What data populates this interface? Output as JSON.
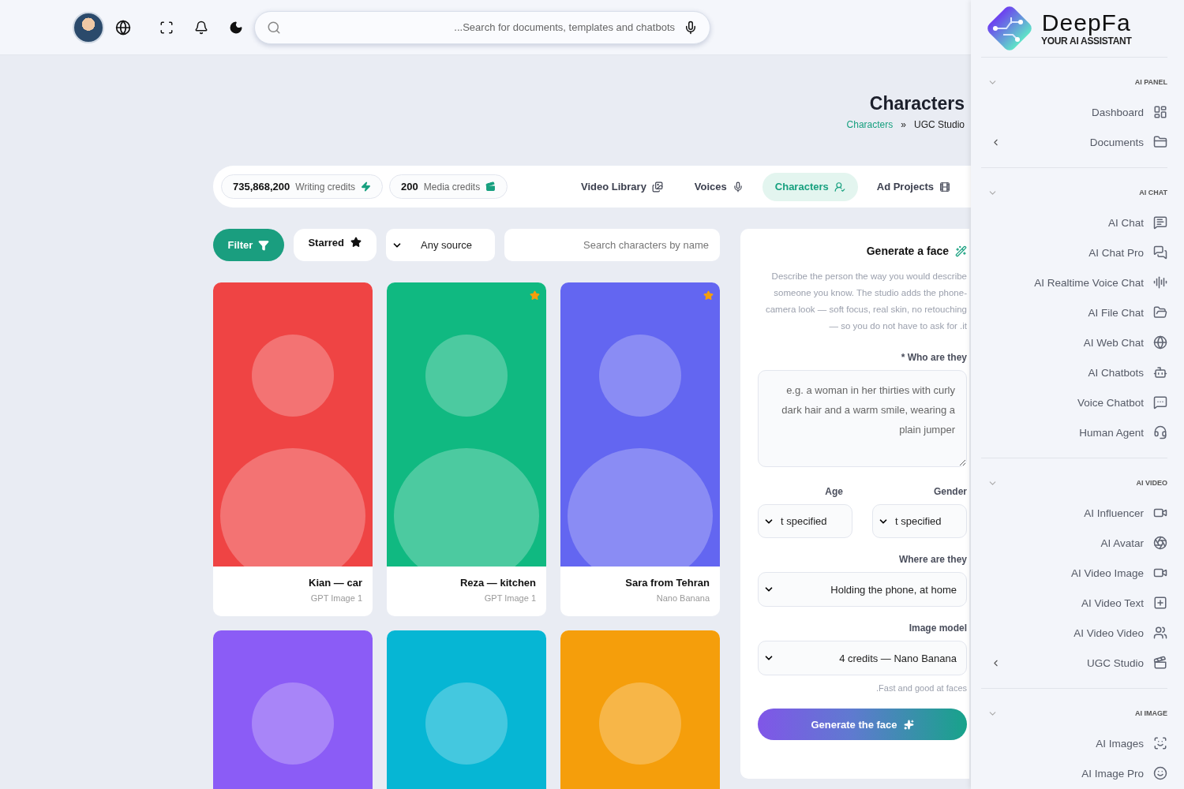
{
  "topbar": {
    "search": {
      "placeholder": "...Search for documents, templates and chatbots"
    }
  },
  "header": {
    "title": "Characters",
    "breadcrumbs": [
      {
        "label": "Characters",
        "link": true
      },
      {
        "label": "»",
        "link": false
      },
      {
        "label": "UGC Studio",
        "link": false
      }
    ]
  },
  "credits": [
    {
      "amount": "735,868,200",
      "label": "Writing credits",
      "kind": "writing"
    },
    {
      "amount": "200",
      "label": "Media credits",
      "kind": "media"
    }
  ],
  "tabs": [
    {
      "label": "Video Library",
      "kind": "library",
      "selected": false
    },
    {
      "label": "Voices",
      "kind": "voices",
      "selected": false
    },
    {
      "label": "Characters",
      "kind": "characters",
      "selected": true
    },
    {
      "label": "Ad Projects",
      "kind": "projects",
      "selected": false
    }
  ],
  "filters": {
    "filter_button": "Filter",
    "starred_button": "Starred",
    "source_select": "Any source",
    "search": {
      "placeholder": "Search characters by name"
    }
  },
  "cards": [
    {
      "name": "Kian — car",
      "source": "GPT Image 1",
      "starred": false,
      "color": "#ef4444"
    },
    {
      "name": "Reza — kitchen",
      "source": "GPT Image 1",
      "starred": true,
      "color": "#10b981"
    },
    {
      "name": "Sara from Tehran",
      "source": "Nano Banana",
      "starred": true,
      "color": "#6366f1"
    },
    {
      "starred": false,
      "color": "#8b5cf6"
    },
    {
      "starred": false,
      "color": "#06b6d4"
    },
    {
      "starred": false,
      "color": "#f59e0b"
    }
  ],
  "generate_panel": {
    "title": "Generate a face",
    "description": "Describe the person the way you would describe someone you know. The studio adds the phone-camera look — soft focus, real skin, no retouching — so you do not have to ask for .it",
    "who_label": "* Who are they",
    "who_placeholder": "e.g. a woman in her thirties with curly dark hair and a warm smile, wearing a plain jumper",
    "age_label": "Age",
    "age_value": "t specified",
    "gender_label": "Gender",
    "gender_value": "t specified",
    "where_label": "Where are they",
    "where_value": "Holding the phone, at home",
    "model_label": "Image model",
    "model_value": "4 credits — Nano Banana",
    "model_hint": ".Fast and good at faces",
    "button": "Generate the face"
  },
  "sidebar": {
    "logo": {
      "name": "DeepFa",
      "tagline": "YOUR AI ASSISTANT"
    },
    "sections": [
      {
        "title": "AI PANEL",
        "expanded": true,
        "items": [
          {
            "label": "Dashboard",
            "has_submenu": false
          },
          {
            "label": "Documents",
            "has_submenu": true
          }
        ]
      },
      {
        "title": "AI CHAT",
        "expanded": true,
        "items": [
          {
            "label": "AI Chat",
            "has_submenu": false
          },
          {
            "label": "AI Chat Pro",
            "has_submenu": false
          },
          {
            "label": "AI Realtime Voice Chat",
            "has_submenu": false
          },
          {
            "label": "AI File Chat",
            "has_submenu": false
          },
          {
            "label": "AI Web Chat",
            "has_submenu": false
          },
          {
            "label": "AI Chatbots",
            "has_submenu": false
          },
          {
            "label": "Voice Chatbot",
            "has_submenu": false
          },
          {
            "label": "Human Agent",
            "has_submenu": false
          }
        ]
      },
      {
        "title": "AI VIDEO",
        "expanded": true,
        "items": [
          {
            "label": "AI Influencer",
            "has_submenu": false
          },
          {
            "label": "AI Avatar",
            "has_submenu": false
          },
          {
            "label": "AI Video Image",
            "has_submenu": false
          },
          {
            "label": "AI Video Text",
            "has_submenu": false
          },
          {
            "label": "AI Video Video",
            "has_submenu": false
          },
          {
            "label": "UGC Studio",
            "has_submenu": true
          }
        ]
      },
      {
        "title": "AI IMAGE",
        "expanded": true,
        "items": [
          {
            "label": "AI Images",
            "has_submenu": false
          },
          {
            "label": "AI Image Pro",
            "has_submenu": false
          }
        ]
      }
    ]
  }
}
